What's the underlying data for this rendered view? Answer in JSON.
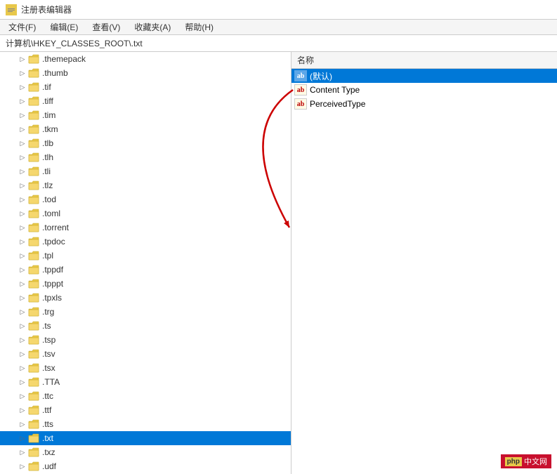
{
  "window": {
    "title": "注册表编辑器",
    "icon": "regedit-icon"
  },
  "menubar": {
    "items": [
      {
        "label": "文件(F)",
        "key": "file"
      },
      {
        "label": "编辑(E)",
        "key": "edit"
      },
      {
        "label": "查看(V)",
        "key": "view"
      },
      {
        "label": "收藏夹(A)",
        "key": "favorites"
      },
      {
        "label": "帮助(H)",
        "key": "help"
      }
    ]
  },
  "breadcrumb": {
    "path": "计算机\\HKEY_CLASSES_ROOT\\.txt"
  },
  "tree": {
    "items": [
      {
        "label": ".themepack",
        "indent": 1,
        "expanded": false,
        "selected": false
      },
      {
        "label": ".thumb",
        "indent": 1,
        "expanded": false,
        "selected": false
      },
      {
        "label": ".tif",
        "indent": 1,
        "expanded": false,
        "selected": false
      },
      {
        "label": ".tiff",
        "indent": 1,
        "expanded": false,
        "selected": false
      },
      {
        "label": ".tim",
        "indent": 1,
        "expanded": false,
        "selected": false
      },
      {
        "label": ".tkm",
        "indent": 1,
        "expanded": false,
        "selected": false
      },
      {
        "label": ".tlb",
        "indent": 1,
        "expanded": false,
        "selected": false
      },
      {
        "label": ".tlh",
        "indent": 1,
        "expanded": false,
        "selected": false
      },
      {
        "label": ".tli",
        "indent": 1,
        "expanded": false,
        "selected": false
      },
      {
        "label": ".tlz",
        "indent": 1,
        "expanded": false,
        "selected": false
      },
      {
        "label": ".tod",
        "indent": 1,
        "expanded": false,
        "selected": false
      },
      {
        "label": ".toml",
        "indent": 1,
        "expanded": false,
        "selected": false
      },
      {
        "label": ".torrent",
        "indent": 1,
        "expanded": false,
        "selected": false
      },
      {
        "label": ".tpdoc",
        "indent": 1,
        "expanded": false,
        "selected": false
      },
      {
        "label": ".tpl",
        "indent": 1,
        "expanded": false,
        "selected": false
      },
      {
        "label": ".tppdf",
        "indent": 1,
        "expanded": false,
        "selected": false
      },
      {
        "label": ".tpppt",
        "indent": 1,
        "expanded": false,
        "selected": false
      },
      {
        "label": ".tpxls",
        "indent": 1,
        "expanded": false,
        "selected": false
      },
      {
        "label": ".trg",
        "indent": 1,
        "expanded": false,
        "selected": false
      },
      {
        "label": ".ts",
        "indent": 1,
        "expanded": false,
        "selected": false
      },
      {
        "label": ".tsp",
        "indent": 1,
        "expanded": false,
        "selected": false
      },
      {
        "label": ".tsv",
        "indent": 1,
        "expanded": false,
        "selected": false
      },
      {
        "label": ".tsx",
        "indent": 1,
        "expanded": false,
        "selected": false
      },
      {
        "label": ".TTA",
        "indent": 1,
        "expanded": false,
        "selected": false
      },
      {
        "label": ".ttc",
        "indent": 1,
        "expanded": false,
        "selected": false
      },
      {
        "label": ".ttf",
        "indent": 1,
        "expanded": false,
        "selected": false
      },
      {
        "label": ".tts",
        "indent": 1,
        "expanded": false,
        "selected": false
      },
      {
        "label": ".txt",
        "indent": 1,
        "expanded": false,
        "selected": true
      },
      {
        "label": ".txz",
        "indent": 1,
        "expanded": false,
        "selected": false
      },
      {
        "label": ".udf",
        "indent": 1,
        "expanded": false,
        "selected": false
      }
    ]
  },
  "right_panel": {
    "column_header": "名称",
    "entries": [
      {
        "name": "(默认)",
        "icon": "ab",
        "selected": true
      },
      {
        "name": "Content Type",
        "icon": "ab",
        "selected": false
      },
      {
        "name": "PerceivedType",
        "icon": "ab",
        "selected": false
      }
    ]
  },
  "watermark": {
    "php_label": "php",
    "site_label": "中文网"
  }
}
